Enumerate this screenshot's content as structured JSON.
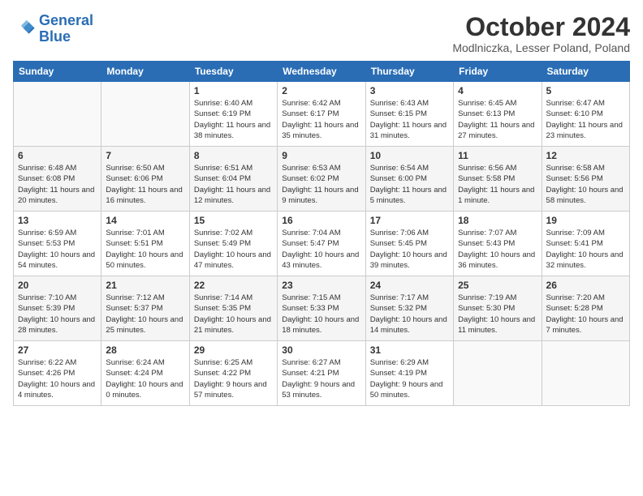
{
  "logo": {
    "line1": "General",
    "line2": "Blue"
  },
  "title": "October 2024",
  "subtitle": "Modlniczka, Lesser Poland, Poland",
  "days_header": [
    "Sunday",
    "Monday",
    "Tuesday",
    "Wednesday",
    "Thursday",
    "Friday",
    "Saturday"
  ],
  "weeks": [
    [
      {
        "num": "",
        "info": ""
      },
      {
        "num": "",
        "info": ""
      },
      {
        "num": "1",
        "info": "Sunrise: 6:40 AM\nSunset: 6:19 PM\nDaylight: 11 hours and 38 minutes."
      },
      {
        "num": "2",
        "info": "Sunrise: 6:42 AM\nSunset: 6:17 PM\nDaylight: 11 hours and 35 minutes."
      },
      {
        "num": "3",
        "info": "Sunrise: 6:43 AM\nSunset: 6:15 PM\nDaylight: 11 hours and 31 minutes."
      },
      {
        "num": "4",
        "info": "Sunrise: 6:45 AM\nSunset: 6:13 PM\nDaylight: 11 hours and 27 minutes."
      },
      {
        "num": "5",
        "info": "Sunrise: 6:47 AM\nSunset: 6:10 PM\nDaylight: 11 hours and 23 minutes."
      }
    ],
    [
      {
        "num": "6",
        "info": "Sunrise: 6:48 AM\nSunset: 6:08 PM\nDaylight: 11 hours and 20 minutes."
      },
      {
        "num": "7",
        "info": "Sunrise: 6:50 AM\nSunset: 6:06 PM\nDaylight: 11 hours and 16 minutes."
      },
      {
        "num": "8",
        "info": "Sunrise: 6:51 AM\nSunset: 6:04 PM\nDaylight: 11 hours and 12 minutes."
      },
      {
        "num": "9",
        "info": "Sunrise: 6:53 AM\nSunset: 6:02 PM\nDaylight: 11 hours and 9 minutes."
      },
      {
        "num": "10",
        "info": "Sunrise: 6:54 AM\nSunset: 6:00 PM\nDaylight: 11 hours and 5 minutes."
      },
      {
        "num": "11",
        "info": "Sunrise: 6:56 AM\nSunset: 5:58 PM\nDaylight: 11 hours and 1 minute."
      },
      {
        "num": "12",
        "info": "Sunrise: 6:58 AM\nSunset: 5:56 PM\nDaylight: 10 hours and 58 minutes."
      }
    ],
    [
      {
        "num": "13",
        "info": "Sunrise: 6:59 AM\nSunset: 5:53 PM\nDaylight: 10 hours and 54 minutes."
      },
      {
        "num": "14",
        "info": "Sunrise: 7:01 AM\nSunset: 5:51 PM\nDaylight: 10 hours and 50 minutes."
      },
      {
        "num": "15",
        "info": "Sunrise: 7:02 AM\nSunset: 5:49 PM\nDaylight: 10 hours and 47 minutes."
      },
      {
        "num": "16",
        "info": "Sunrise: 7:04 AM\nSunset: 5:47 PM\nDaylight: 10 hours and 43 minutes."
      },
      {
        "num": "17",
        "info": "Sunrise: 7:06 AM\nSunset: 5:45 PM\nDaylight: 10 hours and 39 minutes."
      },
      {
        "num": "18",
        "info": "Sunrise: 7:07 AM\nSunset: 5:43 PM\nDaylight: 10 hours and 36 minutes."
      },
      {
        "num": "19",
        "info": "Sunrise: 7:09 AM\nSunset: 5:41 PM\nDaylight: 10 hours and 32 minutes."
      }
    ],
    [
      {
        "num": "20",
        "info": "Sunrise: 7:10 AM\nSunset: 5:39 PM\nDaylight: 10 hours and 28 minutes."
      },
      {
        "num": "21",
        "info": "Sunrise: 7:12 AM\nSunset: 5:37 PM\nDaylight: 10 hours and 25 minutes."
      },
      {
        "num": "22",
        "info": "Sunrise: 7:14 AM\nSunset: 5:35 PM\nDaylight: 10 hours and 21 minutes."
      },
      {
        "num": "23",
        "info": "Sunrise: 7:15 AM\nSunset: 5:33 PM\nDaylight: 10 hours and 18 minutes."
      },
      {
        "num": "24",
        "info": "Sunrise: 7:17 AM\nSunset: 5:32 PM\nDaylight: 10 hours and 14 minutes."
      },
      {
        "num": "25",
        "info": "Sunrise: 7:19 AM\nSunset: 5:30 PM\nDaylight: 10 hours and 11 minutes."
      },
      {
        "num": "26",
        "info": "Sunrise: 7:20 AM\nSunset: 5:28 PM\nDaylight: 10 hours and 7 minutes."
      }
    ],
    [
      {
        "num": "27",
        "info": "Sunrise: 6:22 AM\nSunset: 4:26 PM\nDaylight: 10 hours and 4 minutes."
      },
      {
        "num": "28",
        "info": "Sunrise: 6:24 AM\nSunset: 4:24 PM\nDaylight: 10 hours and 0 minutes."
      },
      {
        "num": "29",
        "info": "Sunrise: 6:25 AM\nSunset: 4:22 PM\nDaylight: 9 hours and 57 minutes."
      },
      {
        "num": "30",
        "info": "Sunrise: 6:27 AM\nSunset: 4:21 PM\nDaylight: 9 hours and 53 minutes."
      },
      {
        "num": "31",
        "info": "Sunrise: 6:29 AM\nSunset: 4:19 PM\nDaylight: 9 hours and 50 minutes."
      },
      {
        "num": "",
        "info": ""
      },
      {
        "num": "",
        "info": ""
      }
    ]
  ]
}
